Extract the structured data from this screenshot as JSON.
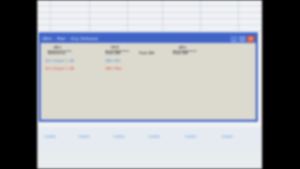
{
  "dialog": {
    "title": "dBm - Mwr - Grp Delease",
    "window_buttons": {
      "minimize": "_",
      "maximize": "□",
      "close": "×"
    },
    "headers": [
      {
        "top": "dBm",
        "bottom": "Reference"
      },
      {
        "top": "MHZ",
        "bottom": "Peak BW"
      },
      {
        "top": "",
        "bottom": "Peak BW"
      },
      {
        "top": "dBm",
        "bottom": "Peak BW"
      }
    ],
    "rows": [
      {
        "label": "Sim Output 1 dB",
        "value": "dBm Min",
        "color": "#4a86c8"
      },
      {
        "label": "Sim Output 1 dB",
        "value": "dBm Max",
        "color": "#e04a3a"
      }
    ]
  },
  "bottom_strip": {
    "labels": [
      "Y.GRID",
      "Y.GRID",
      "Y.GRID",
      "Y.GRID",
      "Y.GRID",
      "Y.GRID"
    ]
  }
}
